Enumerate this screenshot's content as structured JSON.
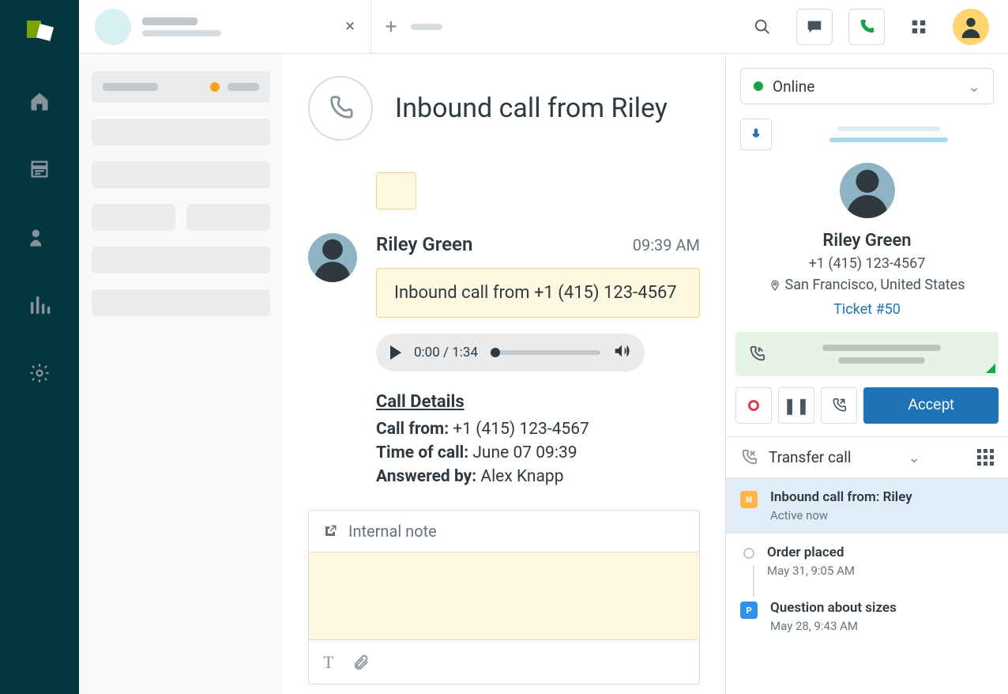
{
  "header": {
    "call_panel_status": "Online"
  },
  "conversation": {
    "title": "Inbound call from Riley",
    "sender_name": "Riley Green",
    "sender_time": "09:39 AM",
    "call_card_text": "Inbound call from +1 (415) 123-4567",
    "audio_time": "0:00 / 1:34",
    "details_heading": "Call Details",
    "call_from_label": "Call from:",
    "call_from_value": " +1 (415) 123-4567",
    "time_label": "Time of call:",
    "time_value": " June 07 09:39",
    "answered_label": "Answered by:",
    "answered_value": " Alex Knapp",
    "composer_tab": "Internal note"
  },
  "call_panel": {
    "caller_name": "Riley Green",
    "caller_phone": "+1 (415) 123-4567",
    "caller_location": "San Francisco, United States",
    "ticket_link": "Ticket #50",
    "accept_label": "Accept",
    "transfer_label": "Transfer call"
  },
  "timeline": [
    {
      "title": "Inbound call from: Riley",
      "sub": "Active now",
      "type": "new"
    },
    {
      "title": "Order placed",
      "sub": "May 31, 9:05 AM",
      "type": "dot"
    },
    {
      "title": "Question about sizes",
      "sub": "May 28, 9:43 AM",
      "type": "pending"
    }
  ]
}
